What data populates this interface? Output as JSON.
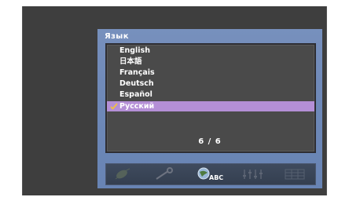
{
  "menu": {
    "title": "Язык",
    "options": [
      {
        "label": "English",
        "selected": false
      },
      {
        "label": "日本語",
        "selected": false
      },
      {
        "label": "Français",
        "selected": false
      },
      {
        "label": "Deutsch",
        "selected": false
      },
      {
        "label": "Español",
        "selected": false
      },
      {
        "label": "Русский",
        "selected": true
      }
    ],
    "page_indicator": "6 / 6",
    "selected_highlight_color": "#b48fd6"
  },
  "toolbar": {
    "icons": [
      {
        "name": "satellite-icon",
        "active": false
      },
      {
        "name": "wrench-icon",
        "active": false
      },
      {
        "name": "language-globe-icon",
        "active": true,
        "text": "ABC"
      },
      {
        "name": "equalizer-icon",
        "active": false
      },
      {
        "name": "data-icon",
        "active": false
      }
    ]
  }
}
